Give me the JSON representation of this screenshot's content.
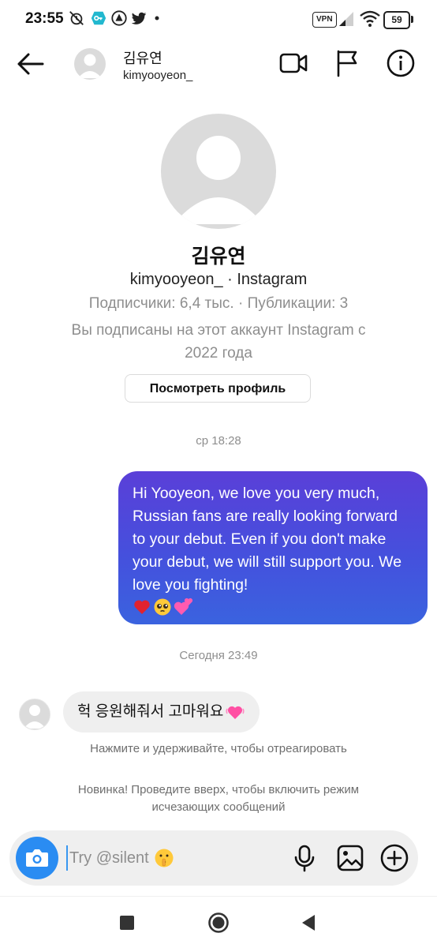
{
  "status_bar": {
    "time": "23:55",
    "vpn_label": "VPN",
    "battery": "59",
    "icons": [
      "silent-alarm-icon",
      "key-icon",
      "app-icon",
      "twitter-icon",
      "dot-icon",
      "signal-icon",
      "wifi-icon",
      "battery-icon"
    ]
  },
  "header": {
    "name": "김유연",
    "username": "kimyooyeon_"
  },
  "profile": {
    "name": "김유연",
    "subtitle": "kimyooyeon_ · Instagram",
    "stats": "Подписчики: 6,4 тыс. · Публикации: 3",
    "follow_line1": "Вы подписаны на этот аккаунт Instagram с",
    "follow_line2": "2022 года",
    "view_button": "Посмотреть профиль"
  },
  "messages": {
    "time_1": "ср 18:28",
    "outgoing_text": "Hi Yooyeon, we love you very much, Russian fans are really looking forward to your debut. Even if you don't make your debut, we will still support you. We love you fighting!",
    "outgoing_emojis": [
      "red-heart",
      "pleading-face",
      "two-hearts"
    ],
    "time_2": "Сегодня 23:49",
    "incoming_text": "헉 응원해줘서 고마워요",
    "incoming_emoji": "growing-heart",
    "react_hint": "Нажмите и удерживайте, чтобы отреагировать"
  },
  "vanish_hint": {
    "line1": "Новинка! Проведите вверх, чтобы включить режим",
    "line2": "исчезающих сообщений"
  },
  "composer": {
    "placeholder": "Try @silent",
    "value": ""
  },
  "colors": {
    "accent": "#2a8cf2",
    "bubble_top": "#5a3fd8",
    "bubble_bottom": "#3a63df",
    "muted": "#8e8e8e"
  }
}
